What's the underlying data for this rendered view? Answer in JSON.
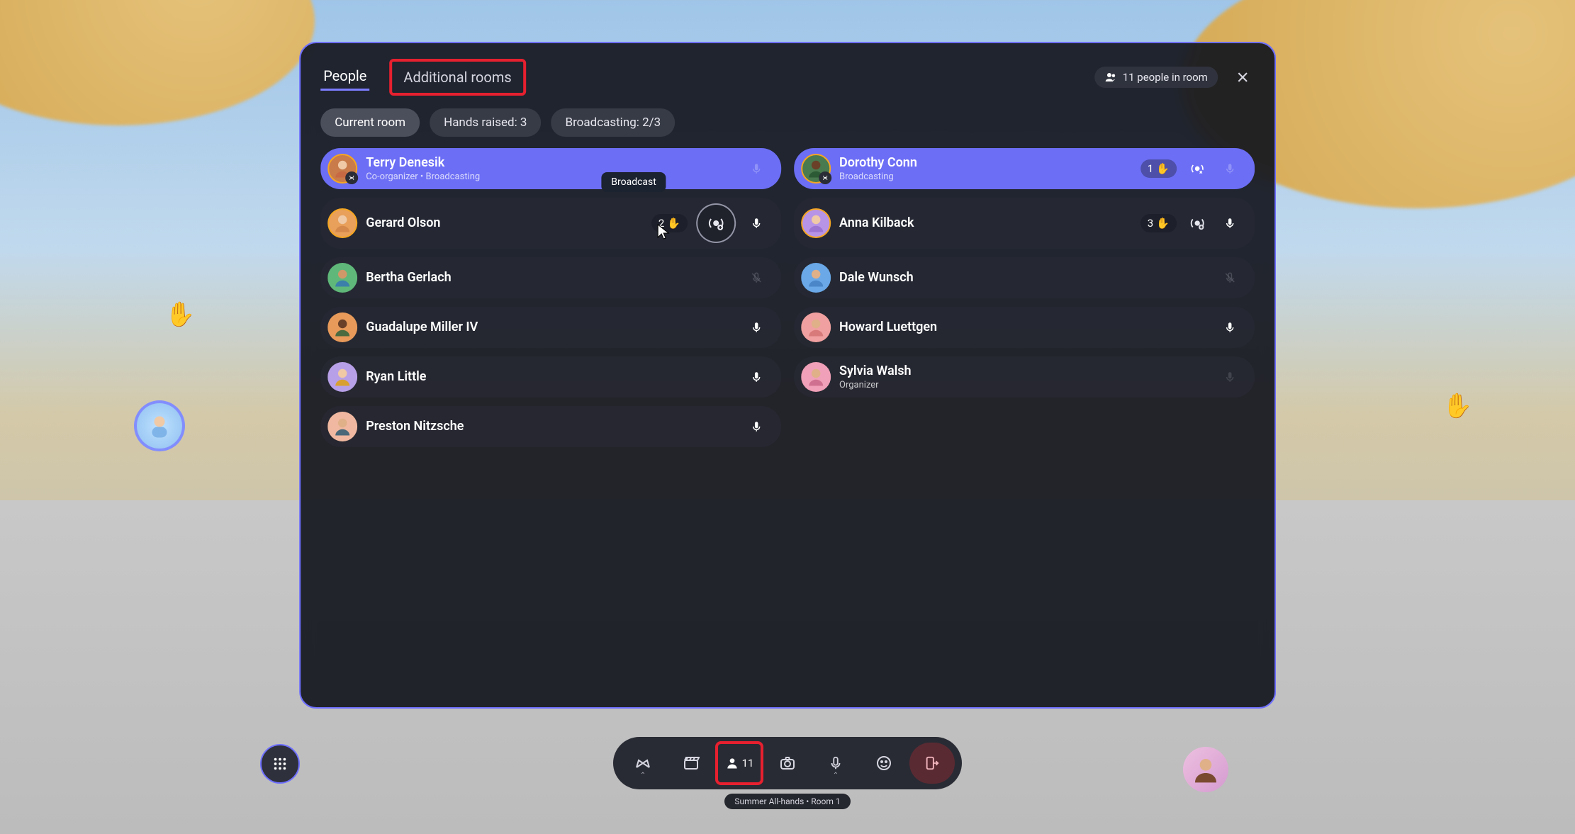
{
  "tabs": {
    "people": "People",
    "additional": "Additional rooms"
  },
  "room_count": "11 people in room",
  "chips": {
    "current": "Current room",
    "hands": "Hands raised: 3",
    "broadcast": "Broadcasting: 2/3"
  },
  "tooltip_broadcast": "Broadcast",
  "left_col": [
    {
      "name": "Terry Denesik",
      "sub": "Co-organizer • Broadcasting"
    },
    {
      "name": "Gerard Olson",
      "hand": "2"
    },
    {
      "name": "Bertha Gerlach"
    },
    {
      "name": "Guadalupe Miller IV"
    },
    {
      "name": "Ryan Little"
    },
    {
      "name": "Preston Nitzsche"
    }
  ],
  "right_col": [
    {
      "name": "Dorothy Conn",
      "sub": "Broadcasting",
      "hand": "1"
    },
    {
      "name": "Anna Kilback",
      "hand": "3"
    },
    {
      "name": "Dale Wunsch"
    },
    {
      "name": "Howard Luettgen"
    },
    {
      "name": "Sylvia Walsh",
      "sub": "Organizer"
    }
  ],
  "toolbar": {
    "people_count": "11"
  },
  "session": "Summer All-hands • Room 1",
  "hand_emoji": "✋"
}
